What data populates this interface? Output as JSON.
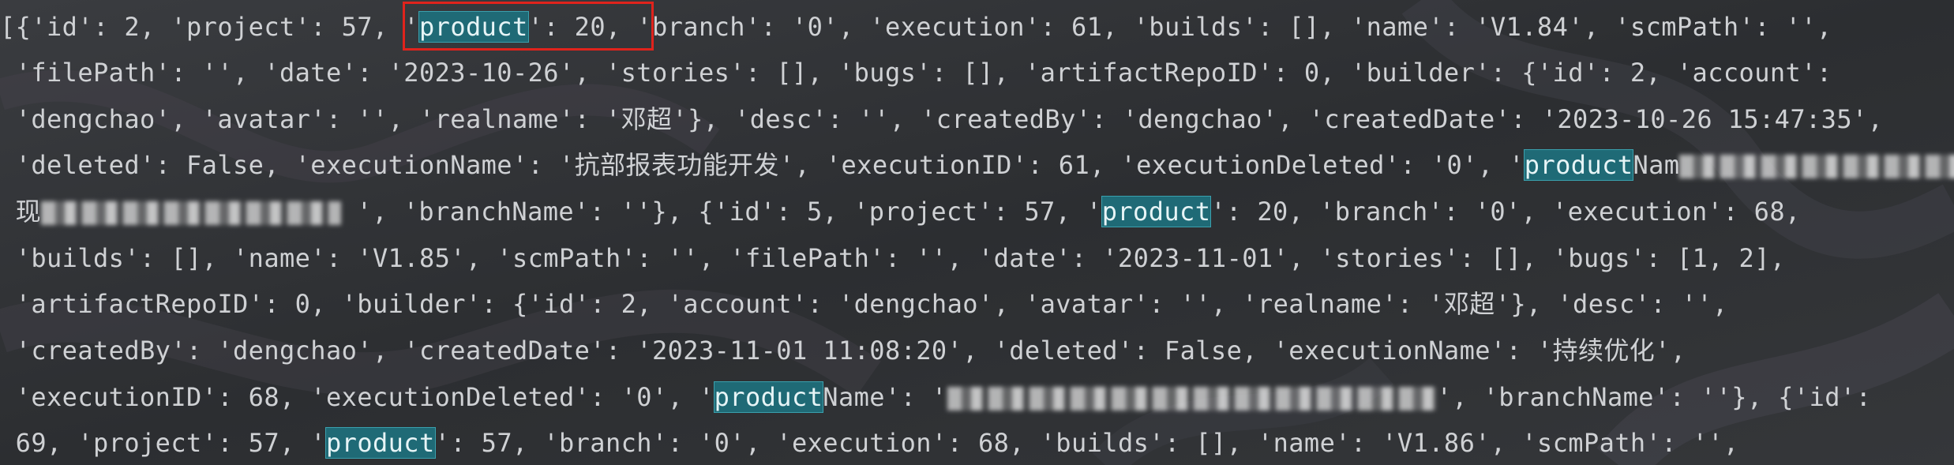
{
  "console": {
    "lines": [
      [
        {
          "t": "[{'id': 2, 'project': 57, '"
        },
        {
          "t": "product",
          "h": true
        },
        {
          "t": "': 20, 'branch': '0', 'execution': 61, 'builds': [], 'name': 'V1.84', 'scmPath': '',"
        }
      ],
      [
        {
          "t": " 'filePath': '', 'date': '2023-10-26', 'stories': [], 'bugs': [], 'artifactRepoID': 0, 'builder': {'id': 2, 'account':"
        }
      ],
      [
        {
          "t": " 'dengchao', 'avatar': '', 'realname': '邓超'}, 'desc': '', 'createdBy': 'dengchao', 'createdDate': '2023-10-26 15:47:35',"
        }
      ],
      [
        {
          "t": " 'deleted': False, 'executionName': '抗部报表功能开发', 'executionID': 61, 'executionDeleted': '0', '"
        },
        {
          "t": "product",
          "h": true
        },
        {
          "t": "Nam"
        },
        {
          "blur": 460
        }
      ],
      [
        {
          "t": " 现"
        },
        {
          "blur": 380
        },
        {
          "t": " ', 'branchName': ''}, {'id': 5, 'project': 57, '"
        },
        {
          "t": "product",
          "h": true
        },
        {
          "t": "': 20, 'branch': '0', 'execution': 68,"
        }
      ],
      [
        {
          "t": " 'builds': [], 'name': 'V1.85', 'scmPath': '', 'filePath': '', 'date': '2023-11-01', 'stories': [], 'bugs': [1, 2],"
        }
      ],
      [
        {
          "t": " 'artifactRepoID': 0, 'builder': {'id': 2, 'account': 'dengchao', 'avatar': '', 'realname': '邓超'}, 'desc': '',"
        }
      ],
      [
        {
          "t": " 'createdBy': 'dengchao', 'createdDate': '2023-11-01 11:08:20', 'deleted': False, 'executionName': '持续优化',"
        }
      ],
      [
        {
          "t": " 'executionID': 68, 'executionDeleted': '0', '"
        },
        {
          "t": "product",
          "h": true
        },
        {
          "t": "Name': '"
        },
        {
          "blur": 620
        },
        {
          "t": "', 'branchName': ''}, {'id':"
        }
      ],
      [
        {
          "t": " 69, 'project': 57, '"
        },
        {
          "t": "product",
          "h": true
        },
        {
          "t": "': 57, 'branch': '0', 'execution': 68, 'builds': [], 'name': 'V1.86', 'scmPath': '',"
        }
      ]
    ]
  },
  "colors": {
    "background": "#2b2d30",
    "text": "#cfd1d4",
    "highlight": "#1f6a76",
    "annotation_box": "#e0231c"
  }
}
